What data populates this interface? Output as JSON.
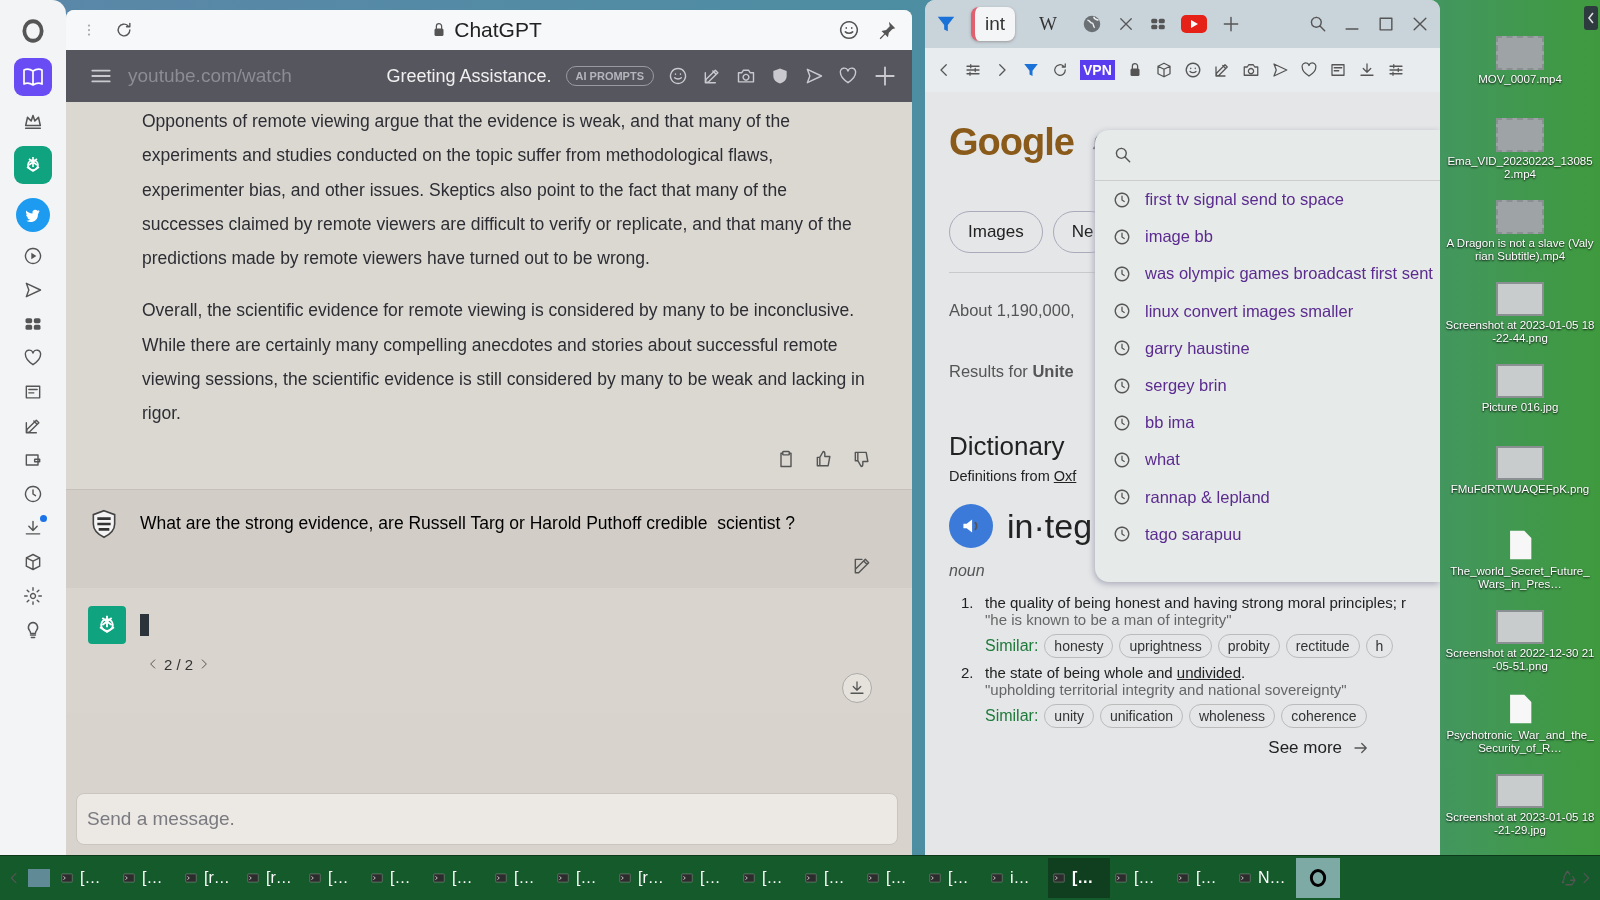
{
  "chat_window": {
    "title": "ChatGPT",
    "header": {
      "ghost_url": "youtube.com/watch",
      "title": "Greeting Assistance.",
      "badge": "AI PROMPTS"
    },
    "messages": [
      {
        "kind": "answer",
        "paragraphs": [
          "Opponents of remote viewing argue that the evidence is weak, and that many of the experiments and studies conducted on the topic suffer from methodological flaws, experimenter bias, and other issues. Skeptics also point to the fact that many of the successes claimed by remote viewers are difficult to verify or replicate, and that many of the predictions made by remote viewers have turned out to be wrong.",
          "Overall, the scientific evidence for remote viewing is considered by many to be inconclusive. While there are certainly many compelling anecdotes and stories about successful remote viewing sessions, the scientific evidence is still considered by many to be weak and lacking in rigor."
        ]
      },
      {
        "kind": "question",
        "text": "What are the strong evidence, are Russell Targ or Harold Puthoff credible  scientist ?"
      },
      {
        "kind": "pending",
        "pager": "2 / 2"
      }
    ],
    "composer": {
      "placeholder": "Send a message."
    }
  },
  "google_window": {
    "tabs": [
      {
        "label": "int",
        "selected": true
      },
      {
        "label": "W",
        "selected": false
      }
    ],
    "vpn_badge": "VPN",
    "page": {
      "logo": "Google",
      "chips": [
        "Images",
        "Ne"
      ],
      "result_count": "About 1,190,000,",
      "results_for": "Results for **Unite**",
      "dictionary": {
        "title": "Dictionary",
        "source": "Definitions from",
        "source_link": "Oxf",
        "word": "in·teg",
        "part_of_speech": "noun",
        "definitions": [
          {
            "number": "1.",
            "text": "the quality of being honest and having strong moral principles; r",
            "example": "\"he is known to be a man of integrity\"",
            "similar_label": "Similar:",
            "similar": [
              "honesty",
              "uprightness",
              "probity",
              "rectitude",
              "h"
            ]
          },
          {
            "number": "2.",
            "text": "the state of being whole and",
            "link": "undivided",
            "suffix": ".",
            "example": "\"upholding territorial integrity and national sovereignty\"",
            "similar_label": "Similar:",
            "similar": [
              "unity",
              "unification",
              "wholeness",
              "coherence"
            ]
          }
        ],
        "see_more": "See more"
      }
    },
    "suggestions": [
      "first tv signal send to space",
      "image bb",
      "was olympic games broadcast first sent",
      "linux convert images smaller",
      "garry haustine",
      "sergey brin",
      "bb ima",
      "what",
      "rannap & lepland",
      "tago sarapuu"
    ]
  },
  "desktop_icons": [
    {
      "kind": "video",
      "label": "MOV_0007.mp4"
    },
    {
      "kind": "video",
      "label": "Ema_VID_20230223_130852.mp4"
    },
    {
      "kind": "video",
      "label": "A Dragon is not a slave (Valyrian Subtitle).mp4"
    },
    {
      "kind": "image",
      "label": "Screenshot at 2023-01-05 18-22-44.png"
    },
    {
      "kind": "image",
      "label": "Picture 016.jpg"
    },
    {
      "kind": "image",
      "label": "FMuFdRTWUAQEFpK.png"
    },
    {
      "kind": "document",
      "label": "The_world_Secret_Future_Wars_in_Pres…"
    },
    {
      "kind": "image",
      "label": "Screenshot at 2022-12-30 21-05-51.png"
    },
    {
      "kind": "document",
      "label": "Psychotronic_War_and_the_Security_of_R…"
    },
    {
      "kind": "image",
      "label": "Screenshot at 2023-01-05 18-21-29.jpg"
    }
  ],
  "taskbar": {
    "items": [
      {
        "label": "[…",
        "selected": false
      },
      {
        "label": "[…",
        "selected": false
      },
      {
        "label": "[r…",
        "selected": false
      },
      {
        "label": "[r…",
        "selected": false
      },
      {
        "label": "[…",
        "selected": false
      },
      {
        "label": "[…",
        "selected": false
      },
      {
        "label": "[…",
        "selected": false
      },
      {
        "label": "[…",
        "selected": false
      },
      {
        "label": "[…",
        "selected": false
      },
      {
        "label": "[r…",
        "selected": false
      },
      {
        "label": "[…",
        "selected": false
      },
      {
        "label": "[…",
        "selected": false
      },
      {
        "label": "[…",
        "selected": false
      },
      {
        "label": "[…",
        "selected": false
      },
      {
        "label": "[…",
        "selected": false
      },
      {
        "label": "i…",
        "selected": false
      },
      {
        "label": "[…",
        "selected": true
      },
      {
        "label": "[…",
        "selected": false
      },
      {
        "label": "[…",
        "selected": false
      },
      {
        "label": "N…",
        "selected": false
      }
    ]
  }
}
